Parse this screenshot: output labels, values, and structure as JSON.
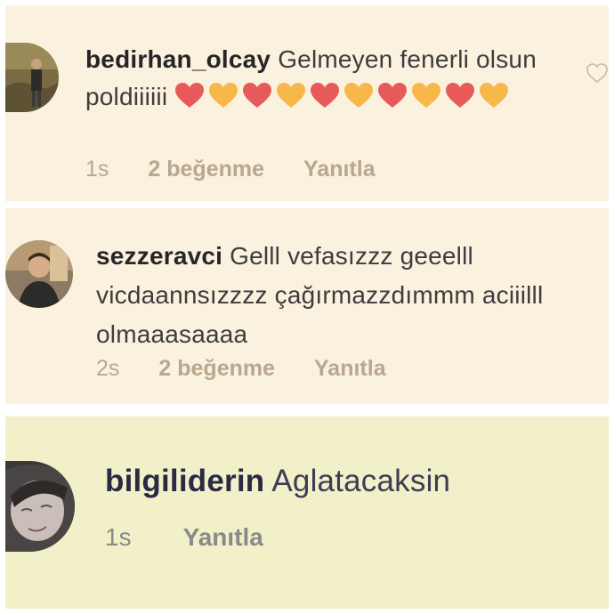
{
  "comments": [
    {
      "username": "bedirhan_olcay",
      "text": "Gelmeyen fenerli olsun poldiiiiii",
      "emojis": [
        "red-heart",
        "yellow-heart",
        "red-heart",
        "yellow-heart",
        "red-heart",
        "yellow-heart",
        "red-heart",
        "yellow-heart",
        "red-heart",
        "yellow-heart"
      ],
      "time": "1s",
      "likes": "2 beğenme",
      "reply": "Yanıtla"
    },
    {
      "username": "sezzeravci",
      "text": "Gelll vefasızzz geeelll vicdaannsızzzz çağırmazzdımmm aciiilll olmaaasaaaa",
      "time": "2s",
      "likes": "2 beğenme",
      "reply": "Yanıtla"
    },
    {
      "username": "bilgiliderin",
      "text": "Aglatacaksin",
      "time": "1s",
      "reply": "Yanıtla"
    }
  ],
  "icons": {
    "like": "heart-outline-icon",
    "red_heart_color": "#e85a5a",
    "yellow_heart_color": "#f7b84a"
  },
  "colors": {
    "panel_bg_1": "#fbf1df",
    "panel_bg_2": "#fbf1df",
    "panel_bg_3": "#f2f0c8",
    "meta_text": "#b9a78e"
  }
}
